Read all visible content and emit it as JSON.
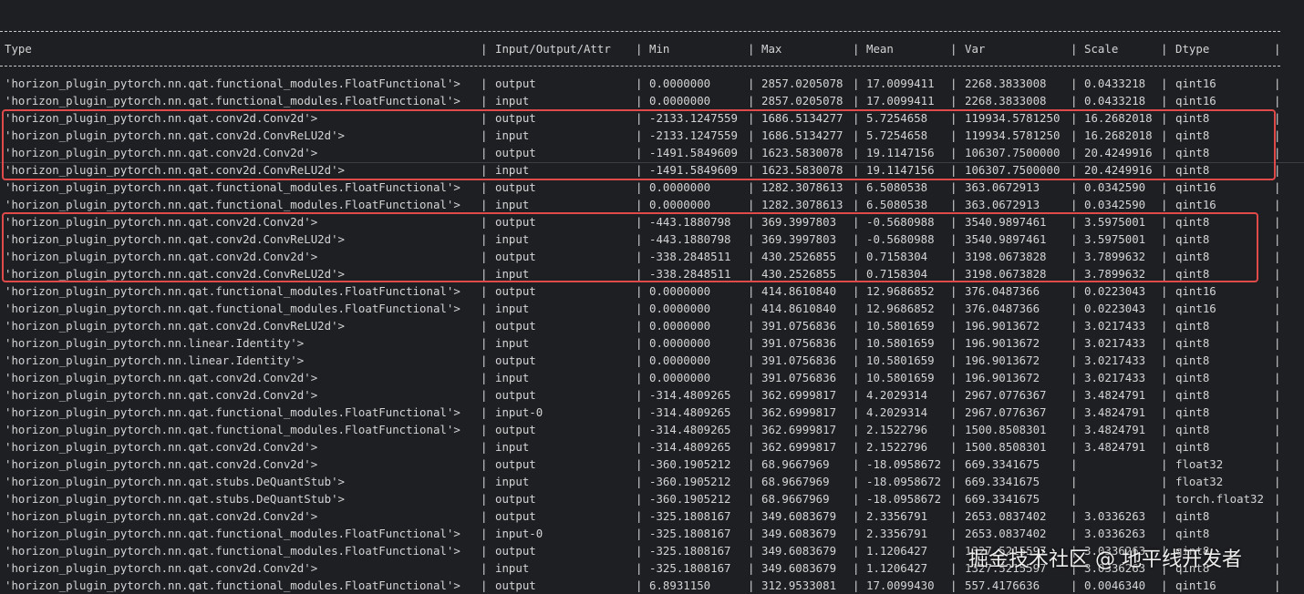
{
  "table": {
    "headers": [
      "Type",
      "Input/Output/Attr",
      "Min",
      "Max",
      "Mean",
      "Var",
      "Scale",
      "Dtype"
    ],
    "rows": [
      [
        "'horizon_plugin_pytorch.nn.qat.functional_modules.FloatFunctional'>",
        "output",
        "0.0000000",
        "2857.0205078",
        "17.0099411",
        "2268.3833008",
        "0.0433218",
        "qint16"
      ],
      [
        "'horizon_plugin_pytorch.nn.qat.functional_modules.FloatFunctional'>",
        "input",
        "0.0000000",
        "2857.0205078",
        "17.0099411",
        "2268.3833008",
        "0.0433218",
        "qint16"
      ],
      [
        "'horizon_plugin_pytorch.nn.qat.conv2d.Conv2d'>",
        "output",
        "-2133.1247559",
        "1686.5134277",
        "5.7254658",
        "119934.5781250",
        "16.2682018",
        "qint8"
      ],
      [
        "'horizon_plugin_pytorch.nn.qat.conv2d.ConvReLU2d'>",
        "input",
        "-2133.1247559",
        "1686.5134277",
        "5.7254658",
        "119934.5781250",
        "16.2682018",
        "qint8"
      ],
      [
        "'horizon_plugin_pytorch.nn.qat.conv2d.Conv2d'>",
        "output",
        "-1491.5849609",
        "1623.5830078",
        "19.1147156",
        "106307.7500000",
        "20.4249916",
        "qint8"
      ],
      [
        "'horizon_plugin_pytorch.nn.qat.conv2d.ConvReLU2d'>",
        "input",
        "-1491.5849609",
        "1623.5830078",
        "19.1147156",
        "106307.7500000",
        "20.4249916",
        "qint8"
      ],
      [
        "'horizon_plugin_pytorch.nn.qat.functional_modules.FloatFunctional'>",
        "output",
        "0.0000000",
        "1282.3078613",
        "6.5080538",
        "363.0672913",
        "0.0342590",
        "qint16"
      ],
      [
        "'horizon_plugin_pytorch.nn.qat.functional_modules.FloatFunctional'>",
        "input",
        "0.0000000",
        "1282.3078613",
        "6.5080538",
        "363.0672913",
        "0.0342590",
        "qint16"
      ],
      [
        "'horizon_plugin_pytorch.nn.qat.conv2d.Conv2d'>",
        "output",
        "-443.1880798",
        "369.3997803",
        "-0.5680988",
        "3540.9897461",
        "3.5975001",
        "qint8"
      ],
      [
        "'horizon_plugin_pytorch.nn.qat.conv2d.ConvReLU2d'>",
        "input",
        "-443.1880798",
        "369.3997803",
        "-0.5680988",
        "3540.9897461",
        "3.5975001",
        "qint8"
      ],
      [
        "'horizon_plugin_pytorch.nn.qat.conv2d.Conv2d'>",
        "output",
        "-338.2848511",
        "430.2526855",
        "0.7158304",
        "3198.0673828",
        "3.7899632",
        "qint8"
      ],
      [
        "'horizon_plugin_pytorch.nn.qat.conv2d.ConvReLU2d'>",
        "input",
        "-338.2848511",
        "430.2526855",
        "0.7158304",
        "3198.0673828",
        "3.7899632",
        "qint8"
      ],
      [
        "'horizon_plugin_pytorch.nn.qat.functional_modules.FloatFunctional'>",
        "output",
        "0.0000000",
        "414.8610840",
        "12.9686852",
        "376.0487366",
        "0.0223043",
        "qint16"
      ],
      [
        "'horizon_plugin_pytorch.nn.qat.functional_modules.FloatFunctional'>",
        "input",
        "0.0000000",
        "414.8610840",
        "12.9686852",
        "376.0487366",
        "0.0223043",
        "qint16"
      ],
      [
        "'horizon_plugin_pytorch.nn.qat.conv2d.ConvReLU2d'>",
        "output",
        "0.0000000",
        "391.0756836",
        "10.5801659",
        "196.9013672",
        "3.0217433",
        "qint8"
      ],
      [
        "'horizon_plugin_pytorch.nn.linear.Identity'>",
        "input",
        "0.0000000",
        "391.0756836",
        "10.5801659",
        "196.9013672",
        "3.0217433",
        "qint8"
      ],
      [
        "'horizon_plugin_pytorch.nn.linear.Identity'>",
        "output",
        "0.0000000",
        "391.0756836",
        "10.5801659",
        "196.9013672",
        "3.0217433",
        "qint8"
      ],
      [
        "'horizon_plugin_pytorch.nn.qat.conv2d.Conv2d'>",
        "input",
        "0.0000000",
        "391.0756836",
        "10.5801659",
        "196.9013672",
        "3.0217433",
        "qint8"
      ],
      [
        "'horizon_plugin_pytorch.nn.qat.conv2d.Conv2d'>",
        "output",
        "-314.4809265",
        "362.6999817",
        "4.2029314",
        "2967.0776367",
        "3.4824791",
        "qint8"
      ],
      [
        "'horizon_plugin_pytorch.nn.qat.functional_modules.FloatFunctional'>",
        "input-0",
        "-314.4809265",
        "362.6999817",
        "4.2029314",
        "2967.0776367",
        "3.4824791",
        "qint8"
      ],
      [
        "'horizon_plugin_pytorch.nn.qat.functional_modules.FloatFunctional'>",
        "output",
        "-314.4809265",
        "362.6999817",
        "2.1522796",
        "1500.8508301",
        "3.4824791",
        "qint8"
      ],
      [
        "'horizon_plugin_pytorch.nn.qat.conv2d.Conv2d'>",
        "input",
        "-314.4809265",
        "362.6999817",
        "2.1522796",
        "1500.8508301",
        "3.4824791",
        "qint8"
      ],
      [
        "'horizon_plugin_pytorch.nn.qat.conv2d.Conv2d'>",
        "output",
        "-360.1905212",
        "68.9667969",
        "-18.0958672",
        "669.3341675",
        "",
        "float32"
      ],
      [
        "'horizon_plugin_pytorch.nn.qat.stubs.DeQuantStub'>",
        "input",
        "-360.1905212",
        "68.9667969",
        "-18.0958672",
        "669.3341675",
        "",
        "float32"
      ],
      [
        "'horizon_plugin_pytorch.nn.qat.stubs.DeQuantStub'>",
        "output",
        "-360.1905212",
        "68.9667969",
        "-18.0958672",
        "669.3341675",
        "",
        "torch.float32"
      ],
      [
        "'horizon_plugin_pytorch.nn.qat.conv2d.Conv2d'>",
        "output",
        "-325.1808167",
        "349.6083679",
        "2.3356791",
        "2653.0837402",
        "3.0336263",
        "qint8"
      ],
      [
        "'horizon_plugin_pytorch.nn.qat.functional_modules.FloatFunctional'>",
        "input-0",
        "-325.1808167",
        "349.6083679",
        "2.3356791",
        "2653.0837402",
        "3.0336263",
        "qint8"
      ],
      [
        "'horizon_plugin_pytorch.nn.qat.functional_modules.FloatFunctional'>",
        "output",
        "-325.1808167",
        "349.6083679",
        "1.1206427",
        "1327.5215597",
        "3.0336263",
        "qint8"
      ],
      [
        "'horizon_plugin_pytorch.nn.qat.conv2d.Conv2d'>",
        "input",
        "-325.1808167",
        "349.6083679",
        "1.1206427",
        "1327.5215597",
        "3.0336263",
        "qint8"
      ],
      [
        "'horizon_plugin_pytorch.nn.qat.functional_modules.FloatFunctional'>",
        "output",
        "6.8931150",
        "312.9533081",
        "17.0099430",
        "557.4176636",
        "0.0046340",
        "qint16"
      ]
    ]
  },
  "watermark": "掘金技术社区 @ 地平线开发者",
  "colors": {
    "background": "#1e1f23",
    "text": "#d4d4d4",
    "highlight": "#e04a4a"
  }
}
